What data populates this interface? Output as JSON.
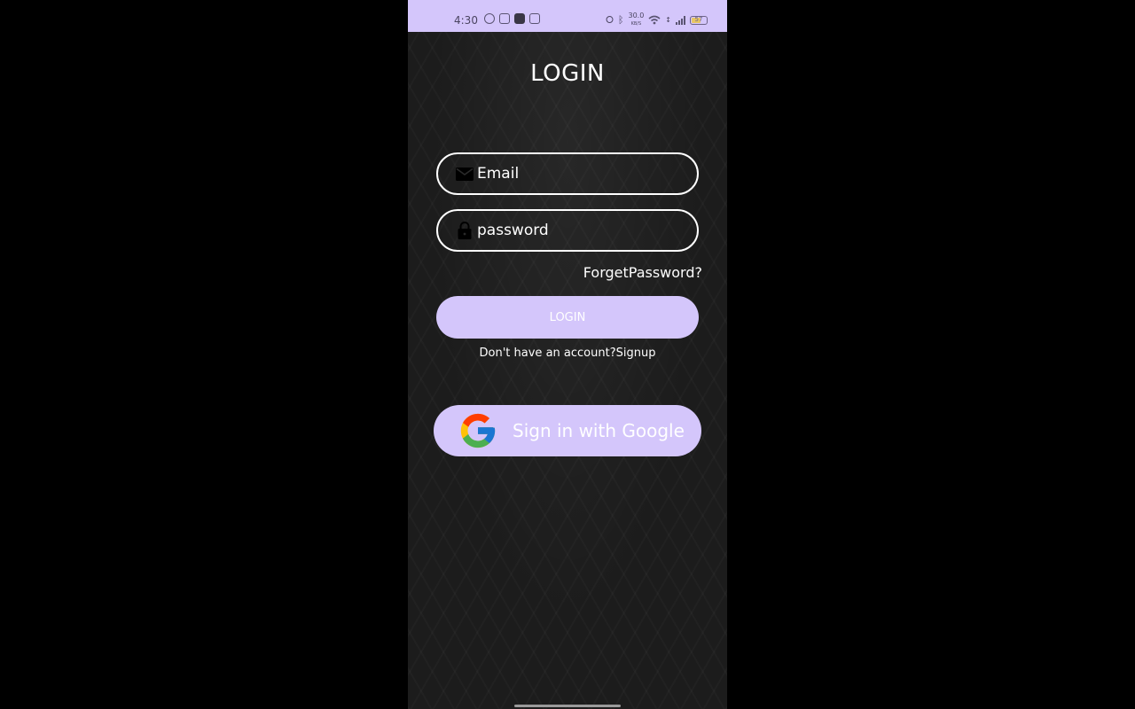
{
  "status_bar": {
    "time": "4:30",
    "left_icons": [
      "whatsapp-icon",
      "youtube-icon",
      "app-icon",
      "instagram-icon"
    ],
    "net_speed_value": "30.0",
    "net_speed_unit": "KB/S",
    "battery": "57",
    "battery_level": 0.57,
    "background_color": "#d4c6fb"
  },
  "screen": {
    "title": "LOGIN",
    "background_color": "#1c1c1c"
  },
  "form": {
    "email_placeholder": "Email",
    "email_icon": "mail-icon",
    "password_placeholder": "password",
    "password_icon": "lock-icon",
    "forget_password": "ForgetPassword?",
    "login_button": "LOGIN",
    "signup_prompt": "Don't have an account?Signup"
  },
  "google": {
    "label": "Sign in with Google",
    "icon": "google-logo-icon"
  },
  "colors": {
    "accent": "#d4c6fb",
    "text": "#ffffff"
  }
}
